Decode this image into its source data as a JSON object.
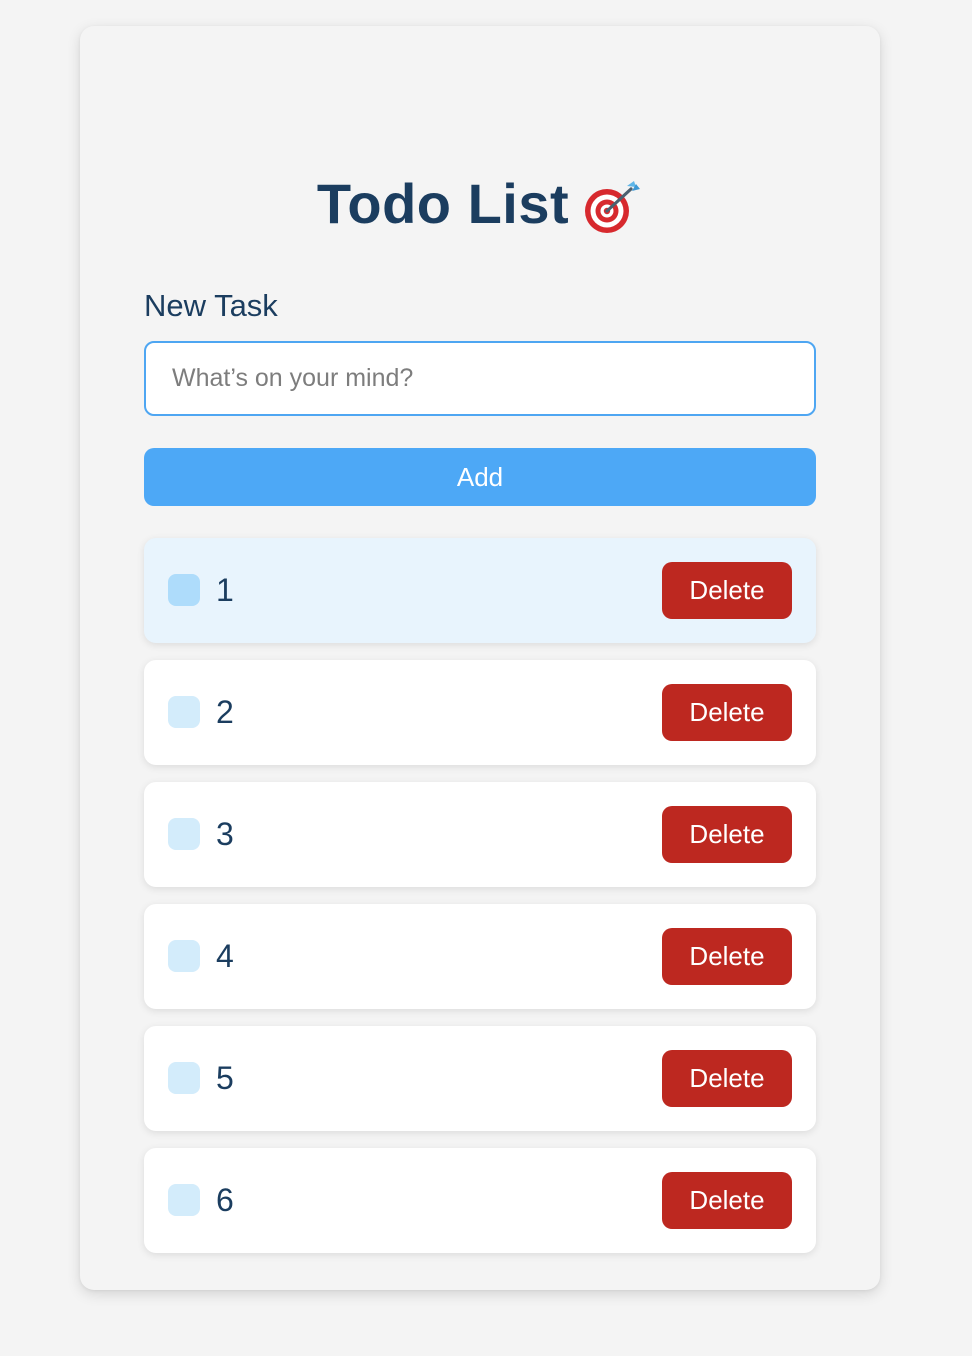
{
  "app": {
    "title": "Todo List",
    "title_icon": "target-dart-icon"
  },
  "form": {
    "label": "New Task",
    "input_value": "",
    "input_placeholder": "What’s on your mind?",
    "add_label": "Add"
  },
  "tasks": [
    {
      "text": "1",
      "done": false,
      "highlighted": true,
      "delete_label": "Delete"
    },
    {
      "text": "2",
      "done": false,
      "highlighted": false,
      "delete_label": "Delete"
    },
    {
      "text": "3",
      "done": false,
      "highlighted": false,
      "delete_label": "Delete"
    },
    {
      "text": "4",
      "done": false,
      "highlighted": false,
      "delete_label": "Delete"
    },
    {
      "text": "5",
      "done": false,
      "highlighted": false,
      "delete_label": "Delete"
    },
    {
      "text": "6",
      "done": false,
      "highlighted": false,
      "delete_label": "Delete"
    }
  ],
  "colors": {
    "page_background": "#f4f4f4",
    "heading": "#1b3d5f",
    "accent": "#4da8f6",
    "delete": "#bd2820",
    "highlight_row": "#e8f4fd",
    "checkbox": "#d3ecfb"
  }
}
